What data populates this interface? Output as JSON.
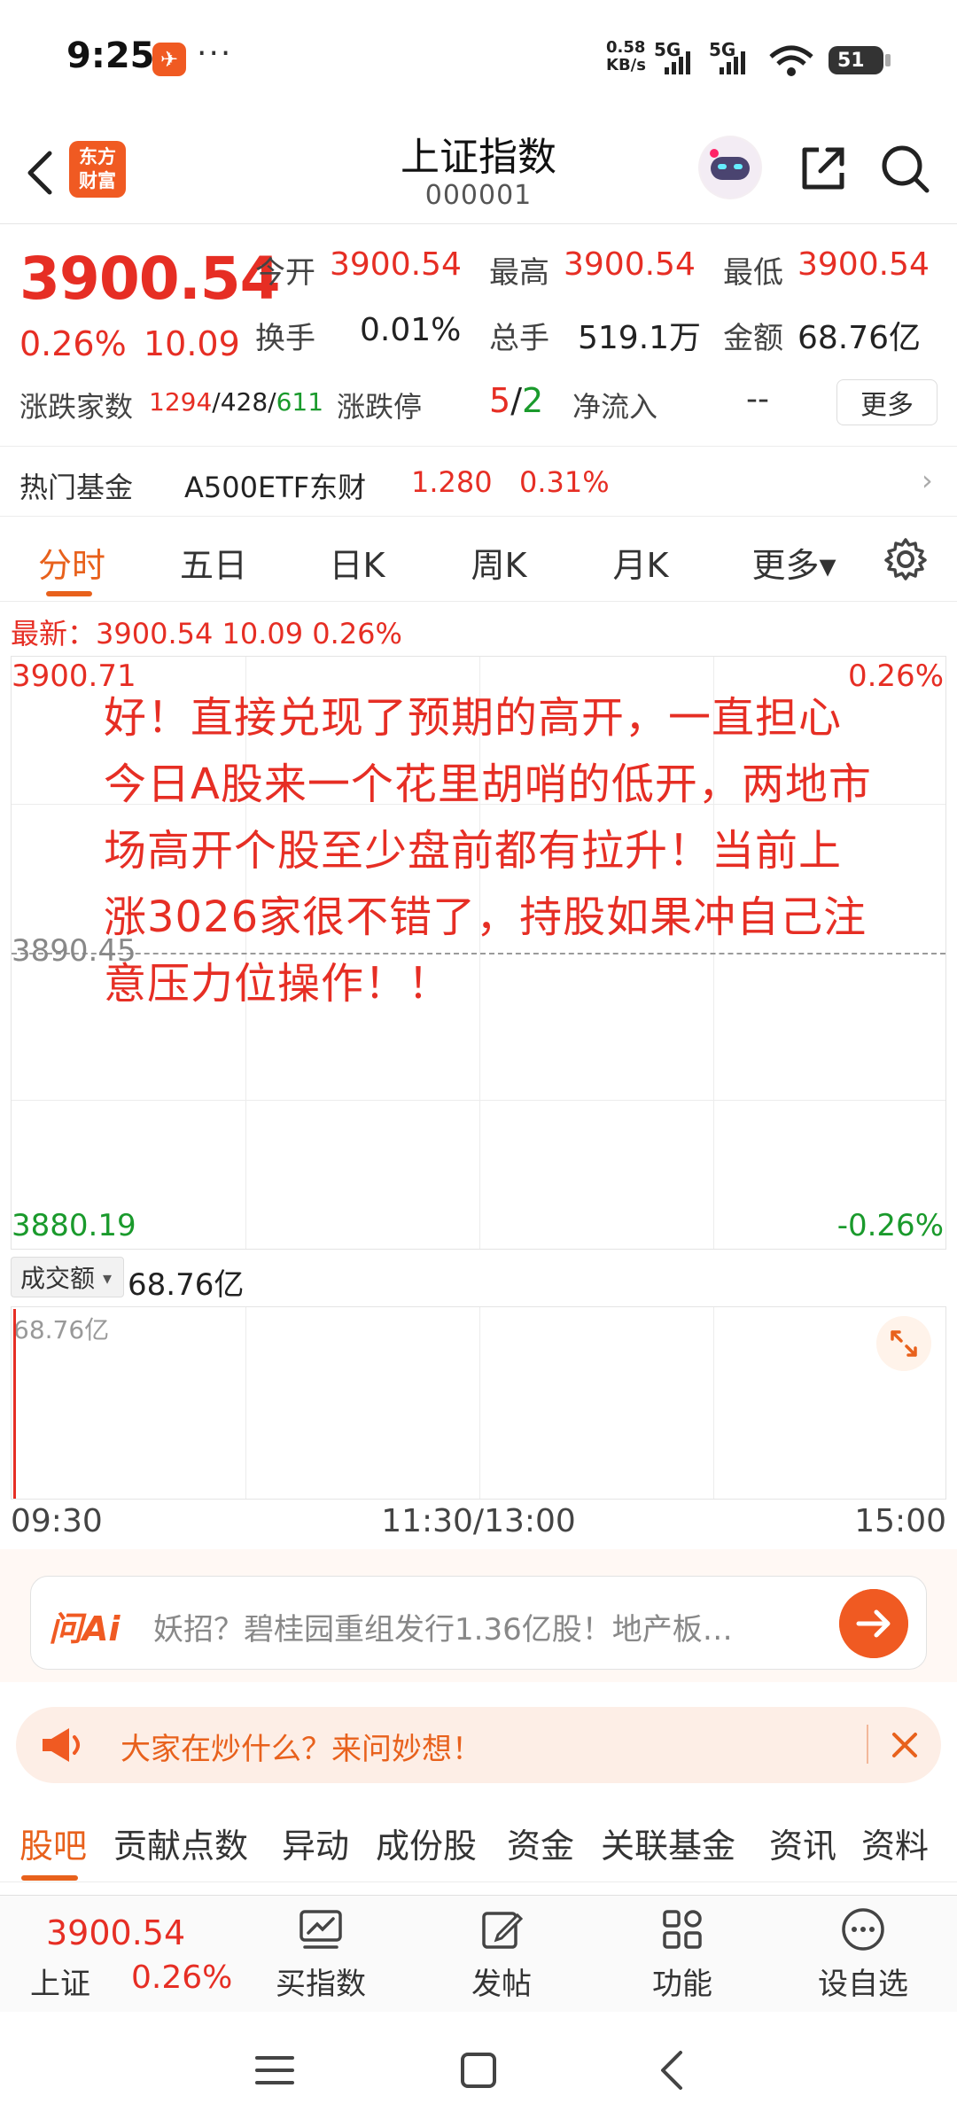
{
  "status_bar": {
    "time": "9:25",
    "app_badge": "✈",
    "more": "···",
    "net_speed_top": "0.58",
    "net_speed_bottom": "KB/s",
    "sig1": "5G",
    "sig2": "5G",
    "battery": "51"
  },
  "header": {
    "brand_line1": "东方",
    "brand_line2": "财富",
    "title": "上证指数",
    "code": "000001"
  },
  "quote": {
    "price": "3900.54",
    "change_pct": "0.26%",
    "change": "10.09",
    "open_label": "今开",
    "open": "3900.54",
    "high_label": "最高",
    "high": "3900.54",
    "low_label": "最低",
    "low": "3900.54",
    "turnover_label": "换手",
    "turnover": "0.01%",
    "volume_label": "总手",
    "volume": "519.1万",
    "amount_label": "金额",
    "amount": "68.76亿",
    "breadth_label": "涨跌家数",
    "breadth_up": "1294",
    "breadth_flat": "428",
    "breadth_down": "611",
    "breadth_sep": "/",
    "limit_label": "涨跌停",
    "limit_up": "5",
    "limit_down": "2",
    "limit_sep": "/",
    "netflow_label": "净流入",
    "netflow": "--",
    "more_button": "更多"
  },
  "hot_fund": {
    "label": "热门基金",
    "name": "A500ETF东财",
    "price": "1.280",
    "change": "0.31%",
    "chevron": "›"
  },
  "tabs": [
    "分时",
    "五日",
    "日K",
    "周K",
    "月K",
    "更多▾"
  ],
  "latest": {
    "text": "最新：3900.54  10.09  0.26%"
  },
  "chart": {
    "y_high": "3900.71",
    "y_mid": "3890.45",
    "y_low": "3880.19",
    "pct_high": "0.26%",
    "pct_low": "-0.26%",
    "comment": "好！直接兑现了预期的高开，一直担心今日A股来一个花里胡哨的低开，两地市场高开个股至少盘前都有拉升！当前上涨3026家很不错了，持股如果冲自己注意压力位操作！！"
  },
  "volume": {
    "label": "成交额",
    "caret": "▾",
    "value": "68.76亿",
    "max": "68.76亿"
  },
  "time_axis": {
    "start": "09:30",
    "mid": "11:30/13:00",
    "end": "15:00"
  },
  "ask_ai": {
    "logo": "问Ai",
    "text": "妖招？碧桂园重组发行1.36亿股！地产板…"
  },
  "banner": {
    "text": "大家在炒什么？来问妙想！"
  },
  "bottom_tabs": [
    "股吧",
    "贡献点数",
    "异动",
    "成份股",
    "资金",
    "关联基金",
    "资讯",
    "资料"
  ],
  "bottom_bar": {
    "price": "3900.54",
    "name": "上证",
    "pct": "0.26%",
    "items": [
      "买指数",
      "发帖",
      "功能",
      "设自选"
    ]
  },
  "colors": {
    "up": "#e62e24",
    "down": "#1a9a2c",
    "accent": "#e8611c"
  }
}
